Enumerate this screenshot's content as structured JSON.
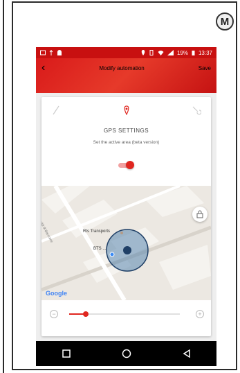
{
  "badge": {
    "letter": "M"
  },
  "status_bar": {
    "battery": "19%",
    "time": "13:37"
  },
  "app_bar": {
    "title": "Modify automation",
    "save_label": "Save",
    "back_icon": "chevron-left-icon"
  },
  "card": {
    "tabs": [
      {
        "name": "pencil-icon",
        "active": false
      },
      {
        "name": "location-pin-icon",
        "active": true
      },
      {
        "name": "wrench-icon",
        "active": false
      }
    ],
    "section_title": "GPS SETTINGS",
    "section_subtitle": "Set the active area (beta version)",
    "toggle_on": true
  },
  "map": {
    "places": [
      {
        "label": "Rts Transports"
      },
      {
        "label": "BTS ..."
      }
    ],
    "street_label": "Via Luigi di Barcomè",
    "google_logo": "Google",
    "lock_icon": "lock-icon"
  },
  "radius_slider": {
    "value": 0.15,
    "minus_icon": "minus-icon",
    "plus_icon": "plus-icon"
  },
  "nav_bar": {
    "buttons": [
      "square-icon",
      "circle-icon",
      "triangle-back-icon"
    ]
  },
  "colors": {
    "accent": "#e0261f",
    "app_bar": "#d91a1a",
    "nav_bar": "#000000"
  }
}
